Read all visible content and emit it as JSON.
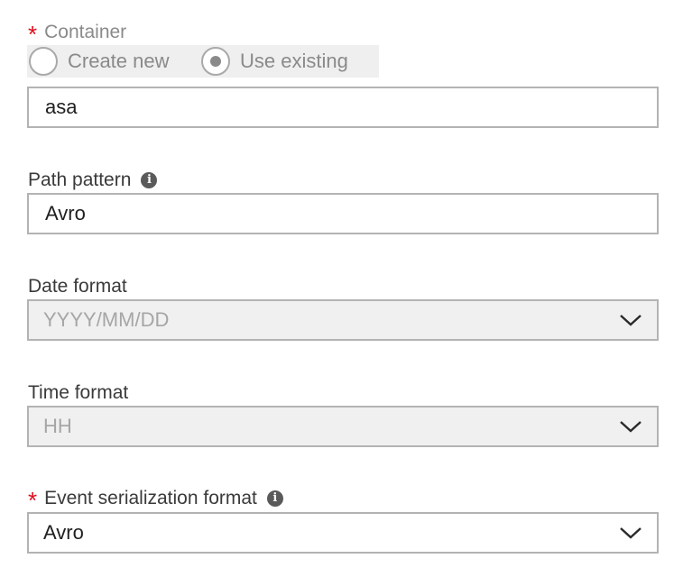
{
  "container": {
    "label": "Container",
    "required_mark": "*",
    "radio_create_label": "Create new",
    "radio_existing_label": "Use existing",
    "selected_option": "Use existing",
    "value": "asa"
  },
  "path_pattern": {
    "label": "Path pattern",
    "value": "Avro"
  },
  "date_format": {
    "label": "Date format",
    "value": "YYYY/MM/DD"
  },
  "time_format": {
    "label": "Time format",
    "value": "HH"
  },
  "event_serialization": {
    "label": "Event serialization format",
    "required_mark": "*",
    "value": "Avro"
  },
  "colors": {
    "required": "#e00b1c",
    "border": "#b3b3b3",
    "disabled_bg": "#f0f0f0"
  },
  "icons": [
    "info-icon",
    "chevron-down-icon"
  ]
}
